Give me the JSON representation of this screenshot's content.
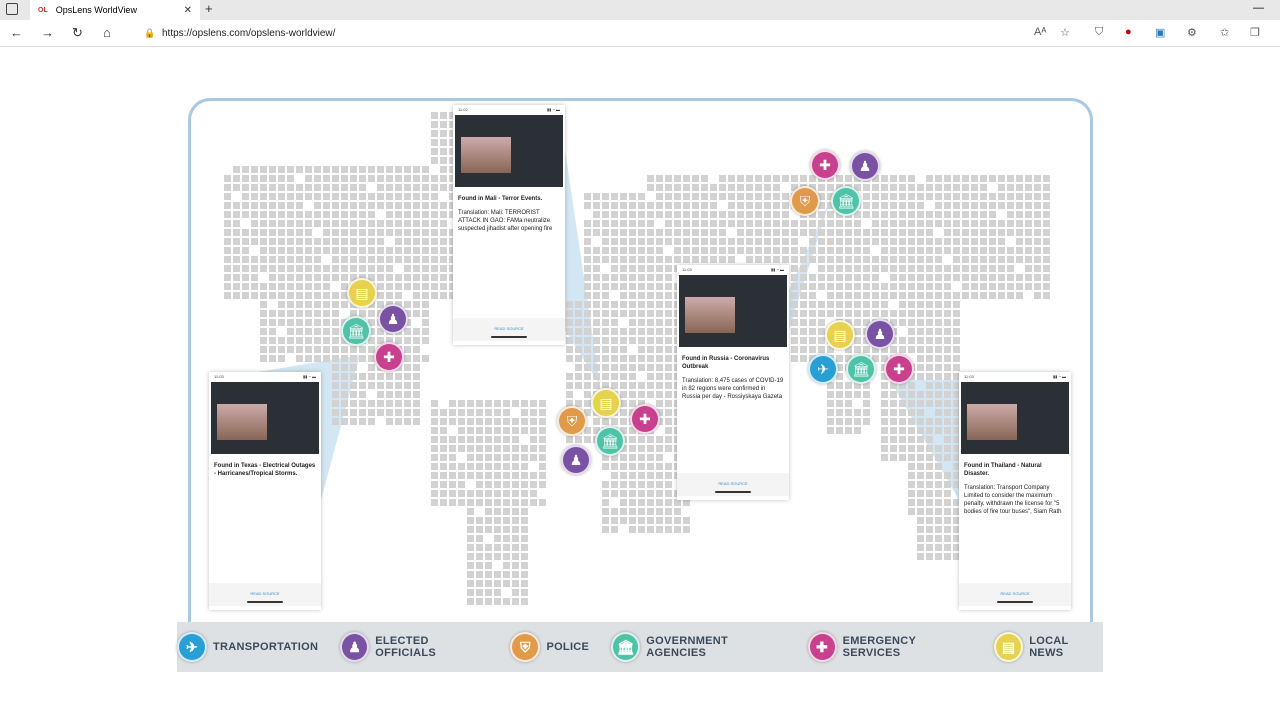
{
  "browser": {
    "tab_title": "OpsLens WorldView",
    "tab_favicon": "OL",
    "url": "https://opslens.com/opslens-worldview/"
  },
  "colors": {
    "transportation": "#2a9fd6",
    "elected_officials": "#7a52a3",
    "police": "#e09a4a",
    "government_agencies": "#4fc3a8",
    "emergency_services": "#c8408e",
    "local_news": "#e6d24e"
  },
  "cards": [
    {
      "id": "mali",
      "time": "11:02",
      "title": "Found in Mali - Terror Events.",
      "body": "Translation: Mali: TERRORIST ATTACK IN GAO: FAMa neutralize suspected jihadist after opening fire",
      "source_label": "READ SOURCE"
    },
    {
      "id": "russia",
      "time": "11:03",
      "title": "Found in Russia - Coronavirus Outbreak",
      "body": "Translation: 8,475 cases of COVID-19 in 82 regions were confirmed in Russia per day - Rossiyskaya Gazeta",
      "source_label": "READ SOURCE"
    },
    {
      "id": "thailand",
      "time": "11:03",
      "title": "Found in Thailand - Natural Disaster.",
      "body": "Translation: Transport Company Limited to consider the maximum penalty, withdrawn the license for \"5 bodies of fire tour buses\", Siam Rath",
      "source_label": "READ SOURCE"
    },
    {
      "id": "texas",
      "time": "11:03",
      "title": "Found in Texas - Electrical Outages - Harricanes/Tropical Storms.",
      "body": "",
      "source_label": "READ SOURCE"
    }
  ],
  "legend": [
    {
      "key": "transportation",
      "label": "TRANSPORTATION",
      "icon": "airplane-icon"
    },
    {
      "key": "elected_officials",
      "label": "ELECTED OFFICIALS",
      "icon": "podium-icon"
    },
    {
      "key": "police",
      "label": "POLICE",
      "icon": "badge-icon"
    },
    {
      "key": "government_agencies",
      "label": "GOVERNMENT AGENCIES",
      "icon": "building-icon"
    },
    {
      "key": "emergency_services",
      "label": "EMERGENCY SERVICES",
      "icon": "ambulance-icon"
    },
    {
      "key": "local_news",
      "label": "LOCAL NEWS",
      "icon": "newspaper-icon"
    }
  ]
}
